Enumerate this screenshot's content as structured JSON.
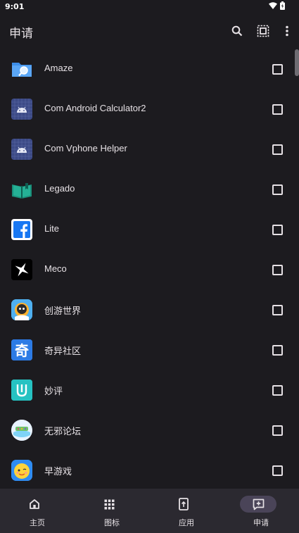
{
  "status": {
    "time": "9:01"
  },
  "appbar": {
    "title": "申请",
    "actions": [
      "search-icon",
      "select-all-icon",
      "more-vert-icon"
    ]
  },
  "apps": [
    {
      "name": "Amaze",
      "icon": "amaze-folder-icon"
    },
    {
      "name": "Com Android Calculator2",
      "icon": "android-default-icon"
    },
    {
      "name": "Com Vphone Helper",
      "icon": "android-default-icon"
    },
    {
      "name": "Legado",
      "icon": "legado-book-icon"
    },
    {
      "name": "Lite",
      "icon": "facebook-icon"
    },
    {
      "name": "Meco",
      "icon": "meco-icon"
    },
    {
      "name": "创游世界",
      "icon": "chuangyou-icon"
    },
    {
      "name": "奇异社区",
      "icon": "qiyi-icon"
    },
    {
      "name": "妙评",
      "icon": "miaoping-icon"
    },
    {
      "name": "无邪论坛",
      "icon": "wuxie-icon"
    },
    {
      "name": "早游戏",
      "icon": "zaoyouxi-icon"
    }
  ],
  "nav": {
    "items": [
      {
        "label": "主页",
        "icon": "home-icon"
      },
      {
        "label": "图标",
        "icon": "grid-icon"
      },
      {
        "label": "应用",
        "icon": "phone-icon"
      },
      {
        "label": "申请",
        "icon": "request-icon"
      }
    ],
    "active": "申请"
  },
  "colors": {
    "background": "#1c1b1f",
    "navbar": "#2b2930",
    "active_pill": "#4a4458",
    "text": "#e6e1e5"
  }
}
